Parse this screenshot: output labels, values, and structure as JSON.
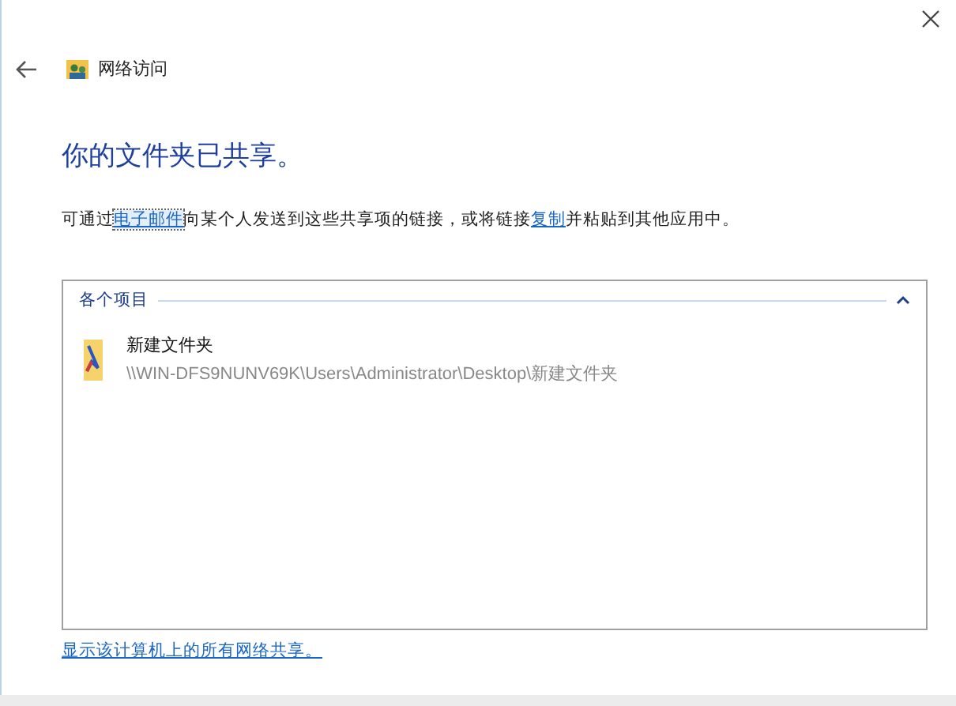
{
  "window": {
    "title": "网络访问"
  },
  "heading": "你的文件夹已共享。",
  "description": [
    {
      "kind": "text",
      "text": "可通过"
    },
    {
      "kind": "link",
      "text": "电子邮件",
      "focused": true
    },
    {
      "kind": "text",
      "text": "向某个人发送到这些共享项的链接，或将链接"
    },
    {
      "kind": "link",
      "text": "复制",
      "focused": false
    },
    {
      "kind": "text",
      "text": "并粘贴到其他应用中。"
    }
  ],
  "group": {
    "title": "各个项目",
    "expanded": true,
    "items": [
      {
        "name": "新建文件夹",
        "path": "\\\\WIN-DFS9NUNV69K\\Users\\Administrator\\Desktop\\新建文件夹"
      }
    ]
  },
  "footer_link": "显示该计算机上的所有网络共享。"
}
